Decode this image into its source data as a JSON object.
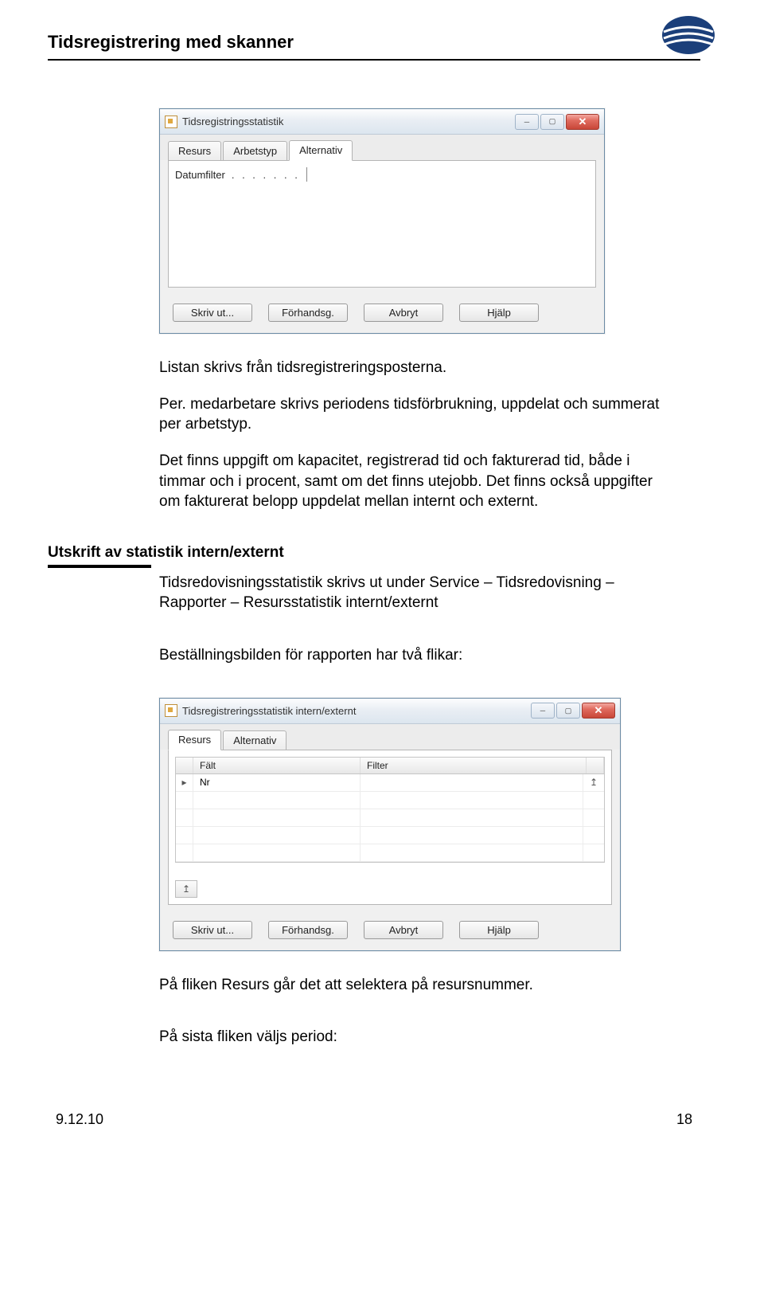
{
  "header": {
    "title": "Tidsregistrering med skanner"
  },
  "dialog1": {
    "title": "Tidsregistringsstatistik",
    "tabs": [
      "Resurs",
      "Arbetstyp",
      "Alternativ"
    ],
    "active_tab": 2,
    "field_label": "Datumfilter",
    "field_value": "",
    "buttons": {
      "print": "Skriv ut...",
      "preview": "Förhandsg.",
      "cancel": "Avbryt",
      "help": "Hjälp"
    }
  },
  "para1": "Listan skrivs från tidsregistreringsposterna.",
  "para2": "Per. medarbetare skrivs periodens tidsförbrukning, uppdelat och summerat per arbetstyp.",
  "para3": "Det finns uppgift om kapacitet, registrerad tid och fakturerad tid, både i timmar och i procent, samt om det finns utejobb. Det finns också uppgifter om fakturerat belopp uppdelat mellan internt och externt.",
  "section_heading": "Utskrift av statistik intern/externt",
  "para4": "Tidsredovisningsstatistik skrivs ut under Service – Tidsredovisning – Rapporter – Resursstatistik internt/externt",
  "para5": "Beställningsbilden för rapporten har två flikar:",
  "dialog2": {
    "title": "Tidsregistreringsstatistik intern/externt",
    "tabs": [
      "Resurs",
      "Alternativ"
    ],
    "active_tab": 0,
    "columns": {
      "falt": "Fält",
      "filter": "Filter"
    },
    "first_row_value": "Nr",
    "buttons": {
      "print": "Skriv ut...",
      "preview": "Förhandsg.",
      "cancel": "Avbryt",
      "help": "Hjälp"
    }
  },
  "para6": "På fliken Resurs går det att selektera på resursnummer.",
  "para7": "På sista fliken väljs period:",
  "footer": {
    "date": "9.12.10",
    "page": "18"
  }
}
